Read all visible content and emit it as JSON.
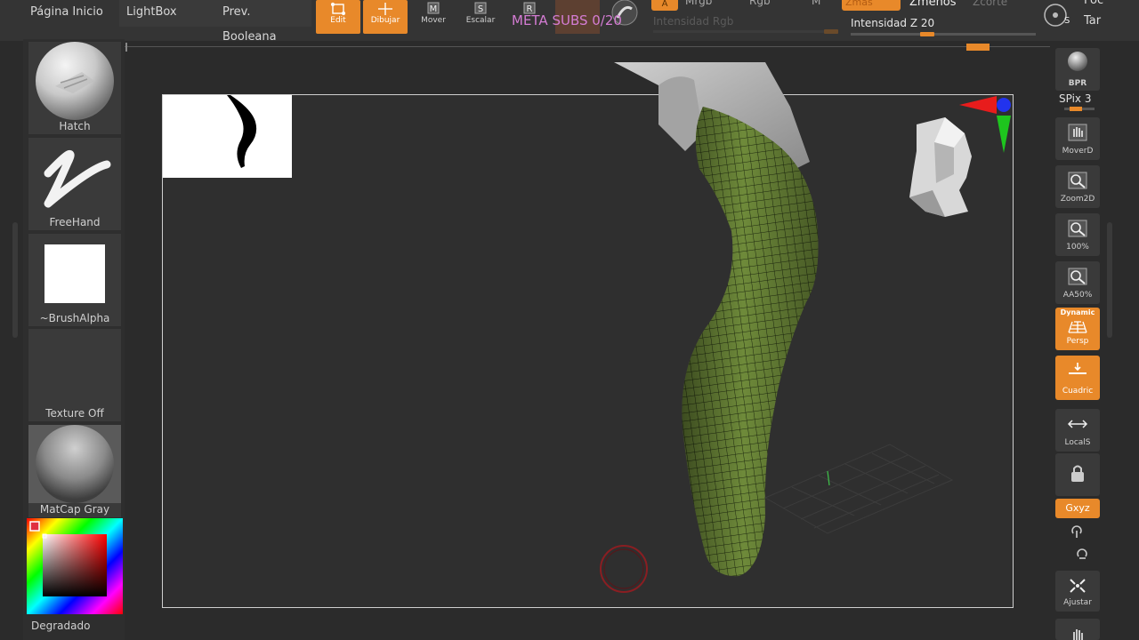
{
  "topbar": {
    "home_label": "Página Inicio",
    "lightbox_label": "LightBox",
    "boolean_label": "Prev. Booleana",
    "tools": [
      {
        "label": "Edit",
        "active": true
      },
      {
        "label": "Dibujar",
        "active": true
      },
      {
        "label": "Mover",
        "active": false
      },
      {
        "label": "Escalar",
        "active": false
      }
    ],
    "mrgb_label": "Mrgb",
    "rgb_label": "Rgb",
    "m_label": "M",
    "a_label": "A",
    "zadd_label": "Zmas",
    "zsub_label": "Zmenos",
    "zcut_label": "Zcorte",
    "rgb_intensity_label": "Intensidad Rgb",
    "z_intensity_label": "Intensidad Z 20",
    "z_intensity_value": 20,
    "right_cut_1": "Foc",
    "right_cut_2": "Tar"
  },
  "overlay": {
    "meta_subs": "META SUBS 0/20"
  },
  "left_shelf": {
    "brush_label": "Hatch",
    "stroke_label": "FreeHand",
    "alpha_label": "~BrushAlpha",
    "texture_label": "Texture Off",
    "material_label": "MatCap Gray",
    "gradient_label": "Degradado"
  },
  "right_shelf": {
    "bpr_label": "BPR",
    "spix_label": "SPix 3",
    "buttons": [
      {
        "label": "MoverD",
        "icon": "move-hand-icon"
      },
      {
        "label": "Zoom2D",
        "icon": "zoom-icon"
      },
      {
        "label": "100%",
        "icon": "zoom-icon"
      },
      {
        "label": "AA50%",
        "icon": "zoom-icon"
      },
      {
        "label_top": "Dynamic",
        "label": "Persp",
        "icon": "perspective-icon",
        "active": true
      },
      {
        "label": "Cuadric",
        "icon": "floor-grid-icon",
        "active": true
      },
      {
        "label": "LocalS",
        "icon": "local-symmetry-icon"
      },
      {
        "label": "",
        "icon": "lock-icon"
      },
      {
        "label": "Gxyz",
        "icon": "xyz-icon",
        "active": true
      },
      {
        "label": "Ajustar",
        "icon": "fit-icon"
      }
    ]
  },
  "colors": {
    "accent": "#e8892a",
    "mesh_green": "#6e8a3a",
    "meta_text": "#d47cd3",
    "canvas_bg": "#2f2f2f"
  }
}
